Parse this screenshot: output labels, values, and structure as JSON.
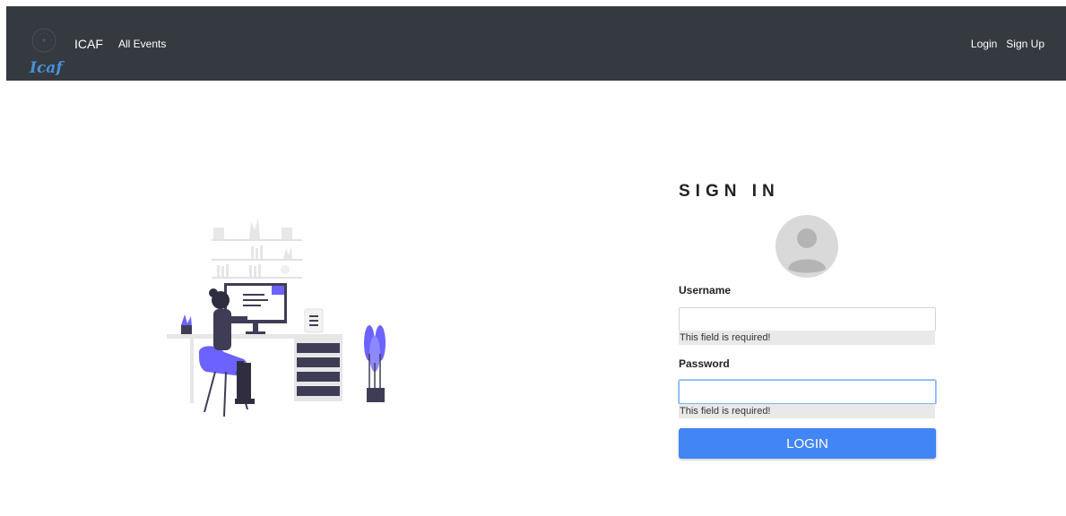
{
  "navbar": {
    "logo_text": "Icaf",
    "brand": "ICAF",
    "nav_link": "All Events",
    "login": "Login",
    "signup": "Sign Up"
  },
  "form": {
    "title": "SIGN IN",
    "username_label": "Username",
    "username_value": "",
    "username_error": "This field is required!",
    "password_label": "Password",
    "password_value": "",
    "password_error": "This field is required!",
    "login_button": "LOGIN"
  },
  "colors": {
    "navbar_bg": "#343a40",
    "button_bg": "#4285f4",
    "illustration_accent": "#6c63ff",
    "error_bg": "#e9e9ea"
  },
  "icons": {
    "avatar": "user-avatar-icon",
    "logo": "icaf-logo-icon"
  }
}
